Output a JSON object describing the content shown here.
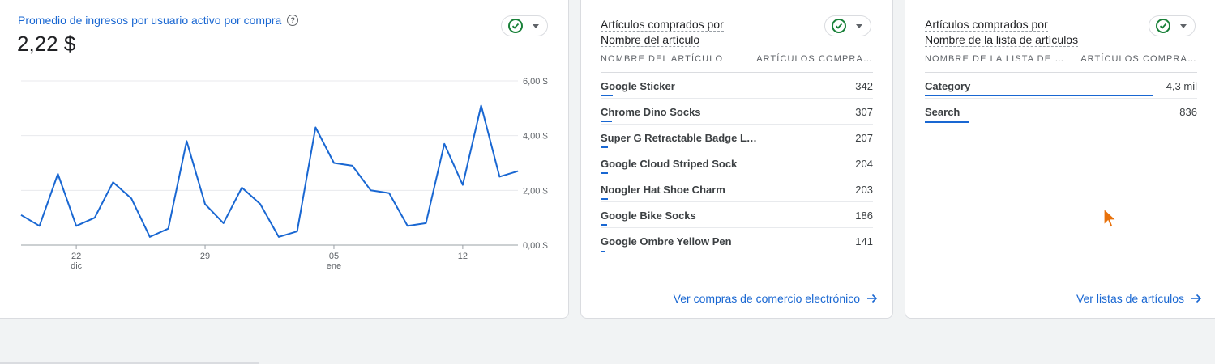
{
  "kpi": {
    "title": "Promedio de ingresos por usuario activo por compra",
    "help_icon": "help-circle-icon",
    "value": "2,22 $"
  },
  "chart_data": {
    "type": "line",
    "series": [
      {
        "values": [
          1.1,
          0.7,
          2.6,
          0.7,
          1.0,
          2.3,
          1.7,
          0.3,
          0.6,
          3.8,
          1.5,
          0.8,
          2.1,
          1.5,
          0.3,
          0.5,
          4.3,
          3.0,
          2.9,
          2.0,
          1.9,
          0.7,
          0.8,
          3.7,
          2.2,
          5.1,
          2.5,
          2.7
        ]
      }
    ],
    "x_start_date": "2023-12-19",
    "x_ticks": [
      {
        "index": 3,
        "label": "22",
        "sub": "dic"
      },
      {
        "index": 10,
        "label": "29",
        "sub": ""
      },
      {
        "index": 17,
        "label": "05",
        "sub": "ene"
      },
      {
        "index": 24,
        "label": "12",
        "sub": ""
      }
    ],
    "y_ticks": [
      "0,00 $",
      "2,00 $",
      "4,00 $",
      "6,00 $"
    ],
    "ylim": [
      0,
      6
    ],
    "color": "#1967d2",
    "grid": true
  },
  "items_table": {
    "title_line1": "Artículos comprados por",
    "title_line2": "Nombre del artículo",
    "col1": "NOMBRE DEL ARTÍCULO",
    "col2": "ARTÍCULOS COMPRA…",
    "rows": [
      {
        "name": "Google Sticker",
        "value": "342",
        "share": 0.046
      },
      {
        "name": "Chrome Dino Socks",
        "value": "307",
        "share": 0.041
      },
      {
        "name": "Super G Retractable Badge L…",
        "value": "207",
        "share": 0.028
      },
      {
        "name": "Google Cloud Striped Sock",
        "value": "204",
        "share": 0.028
      },
      {
        "name": "Noogler Hat Shoe Charm",
        "value": "203",
        "share": 0.027
      },
      {
        "name": "Google Bike Socks",
        "value": "186",
        "share": 0.025
      },
      {
        "name": "Google Ombre Yellow Pen",
        "value": "141",
        "share": 0.019
      }
    ],
    "link": "Ver compras de comercio electrónico"
  },
  "lists_table": {
    "title_line1": "Artículos comprados por",
    "title_line2": "Nombre de la lista de artículos",
    "col1": "NOMBRE DE LA LISTA DE …",
    "col2": "ARTÍCULOS COMPRA…",
    "rows": [
      {
        "name": "Category",
        "value": "4,3 mil",
        "share": 0.84
      },
      {
        "name": "Search",
        "value": "836",
        "share": 0.16
      }
    ],
    "link": "Ver listas de artículos"
  },
  "colors": {
    "accent": "#1967d2",
    "check": "#188038",
    "cursor": "#e8710a"
  }
}
